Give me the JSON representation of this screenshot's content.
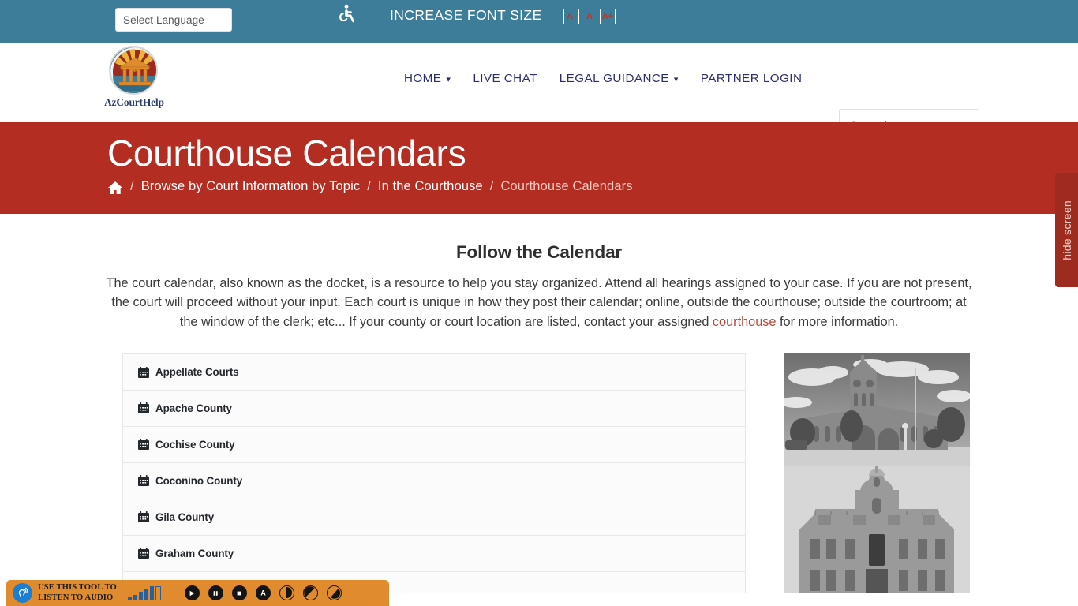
{
  "topbar": {
    "language_label": "Select Language",
    "accessibility_icon": "wheelchair-icon",
    "increase_font_label": "INCREASE FONT SIZE",
    "font_buttons": [
      {
        "label": "A-",
        "name": "decrease-font-button"
      },
      {
        "label": "A",
        "name": "reset-font-button"
      },
      {
        "label": "A+",
        "name": "increase-font-button"
      }
    ],
    "bg_color": "#3d7d99"
  },
  "header": {
    "logo_text": "AzCourtHelp",
    "nav": [
      {
        "label": "HOME",
        "has_caret": true
      },
      {
        "label": "LIVE CHAT",
        "has_caret": false
      },
      {
        "label": "LEGAL GUIDANCE",
        "has_caret": true
      },
      {
        "label": "PARTNER LOGIN",
        "has_caret": false
      }
    ],
    "search": {
      "value": "",
      "placeholder": "Search ..."
    }
  },
  "hero": {
    "title": "Courthouse Calendars",
    "bg_color": "#b32d22",
    "breadcrumb": {
      "home_icon": "home-icon",
      "separator": "/",
      "items": [
        {
          "label": "Browse by Court Information by Topic",
          "current": false
        },
        {
          "label": "In the Courthouse",
          "current": false
        },
        {
          "label": "Courthouse Calendars",
          "current": true
        }
      ]
    },
    "hide_screen_label": "hide screen"
  },
  "main": {
    "heading": "Follow the Calendar",
    "paragraph_part_1": "The court calendar, also known as the docket, is a resource to help you stay organized. Attend all hearings assigned to your case.  If you are not present, the court will proceed without your input.  Each court is unique in how they post their calendar; online, outside the courthouse; outside the courtroom; at the window of the clerk; etc...  If your county or court location are listed, contact your assigned ",
    "paragraph_link": "courthouse",
    "paragraph_part_2": " for more information.",
    "accordion": {
      "icon": "calendar-icon",
      "items": [
        {
          "label": "Appellate Courts"
        },
        {
          "label": "Apache County"
        },
        {
          "label": "Cochise County"
        },
        {
          "label": "Coconino County"
        },
        {
          "label": "Gila County"
        },
        {
          "label": "Graham County"
        }
      ]
    },
    "photos": [
      {
        "name": "historic-courthouse-photo-1",
        "alt": "Historic courthouse with clock tower"
      },
      {
        "name": "historic-courthouse-photo-2",
        "alt": "Historic courthouse with dome"
      }
    ]
  },
  "audio_toolbar": {
    "ear_icon": "ear-listen-icon",
    "text_line_1": "USE THIS TOOL TO",
    "text_line_2": "LISTEN TO AUDIO",
    "bg_color": "#e08b2d",
    "volume_levels": [
      4,
      7,
      11,
      14,
      18
    ],
    "controls": [
      {
        "name": "play-button",
        "icon": "play-icon"
      },
      {
        "name": "pause-button",
        "icon": "pause-icon"
      },
      {
        "name": "stop-button",
        "icon": "stop-icon"
      },
      {
        "name": "text-size-button",
        "icon": "letter-a-icon"
      },
      {
        "name": "contrast-button",
        "icon": "contrast-half-icon"
      },
      {
        "name": "invert-button",
        "icon": "contrast-diagonal-icon"
      },
      {
        "name": "theme-button",
        "icon": "contrast-wedge-icon"
      }
    ]
  }
}
